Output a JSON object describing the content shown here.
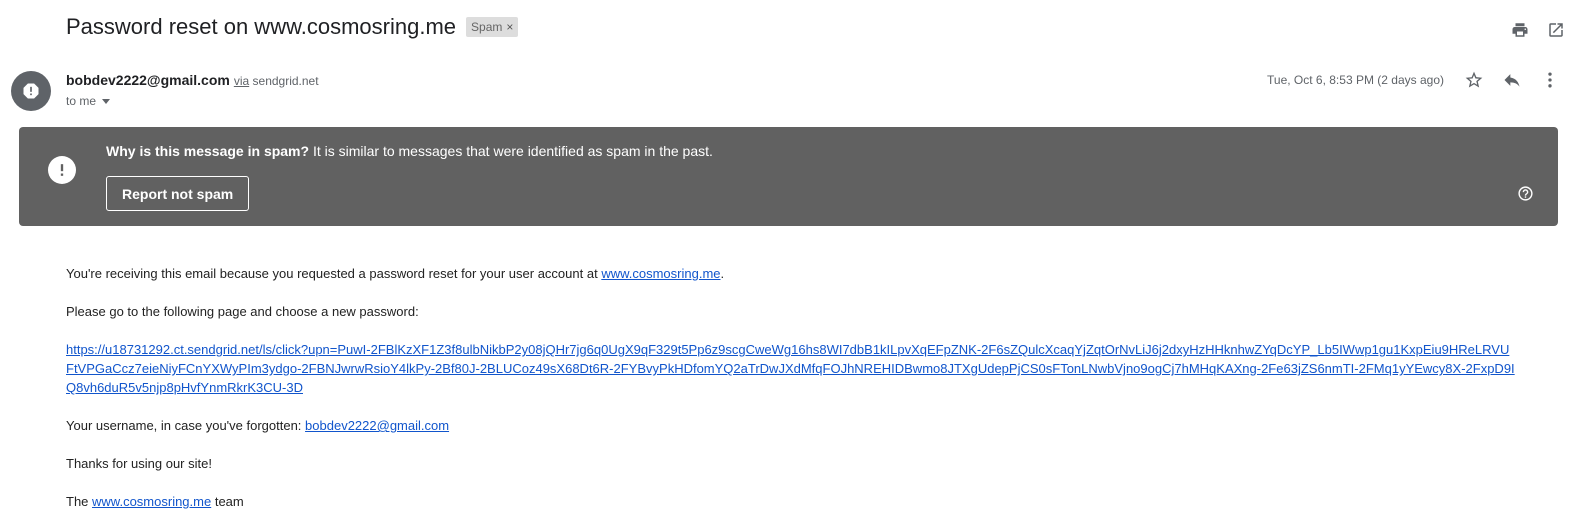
{
  "email": {
    "subject": "Password reset on www.cosmosring.me",
    "label": "Spam",
    "label_close": "×",
    "sender": "bobdev2222@gmail.com",
    "via_word": "via",
    "via_domain": "sendgrid.net",
    "to": "to me",
    "date": "Tue, Oct 6, 8:53 PM (2 days ago)"
  },
  "spam_banner": {
    "why_bold": "Why is this message in spam?",
    "why_text": " It is similar to messages that were identified as spam in the past.",
    "report_button": "Report not spam"
  },
  "body": {
    "line1_text": "You're receiving this email because you requested a password reset for your user account at ",
    "line1_link": "www.cosmosring.me",
    "line1_end": ".",
    "line2": "Please go to the following page and choose a new password:",
    "reset_link": "https://u18731292.ct.sendgrid.net/ls/click?upn=PuwI-2FBlKzXF1Z3f8ulbNikbP2y08jQHr7jg6q0UgX9qF329t5Pp6z9scgCweWg16hs8WI7dbB1kILpvXqEFpZNK-2F6sZQulcXcaqYjZqtOrNvLiJ6j2dxyHzHHknhwZYqDcYP_Lb5IWwp1gu1KxpEiu9HReLRVUFtVPGaCcz7eieNiyFCnYXWyPIm3ydgo-2FBNJwrwRsioY4lkPy-2Bf80J-2BLUCoz49sX68Dt6R-2FYBvyPkHDfomYQ2aTrDwJXdMfqFOJhNREHIDBwmo8JTXgUdepPjCS0sFTonLNwbVjno9ogCj7hMHqKAXng-2Fe63jZS6nmTI-2FMq1yYEwcy8X-2FxpD9IQ8vh6duR5v5njp8pHvfYnmRkrK3CU-3D",
    "username_text": "Your username, in case you've forgotten: ",
    "username_link": "bobdev2222@gmail.com",
    "thanks": "Thanks for using our site!",
    "sign_pre": "The ",
    "sign_link": "www.cosmosring.me",
    "sign_post": " team"
  },
  "icons": {
    "print": "print-icon",
    "open_new": "open-in-new-window-icon",
    "star": "star-icon",
    "reply": "reply-icon",
    "more": "more-vert-icon",
    "warning": "warning-icon",
    "help": "help-icon"
  },
  "colors": {
    "banner_bg": "#616161",
    "link": "#1155cc",
    "avatar_bg": "#5f6368"
  }
}
